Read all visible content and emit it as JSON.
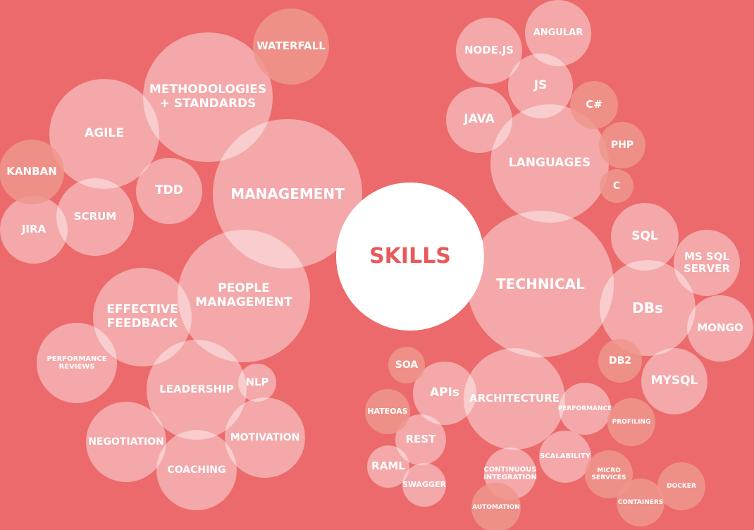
{
  "bubbles": [
    {
      "id": "waterfall",
      "label": "WATERFALL",
      "alt": true
    },
    {
      "id": "methodologies",
      "label": "METHODOLOGIES\n+ STANDARDS"
    },
    {
      "id": "agile",
      "label": "AGILE"
    },
    {
      "id": "management",
      "label": "MANAGEMENT"
    },
    {
      "id": "kanban",
      "label": "KANBAN",
      "alt": true
    },
    {
      "id": "tdd",
      "label": "TDD"
    },
    {
      "id": "jira",
      "label": "JIRA"
    },
    {
      "id": "scrum",
      "label": "SCRUM"
    },
    {
      "id": "people-management",
      "label": "PEOPLE\nMANAGEMENT"
    },
    {
      "id": "effective-feedback",
      "label": "EFFECTIVE\nFEEDBACK"
    },
    {
      "id": "performance-reviews",
      "label": "PERFORMANCE\nREVIEWS"
    },
    {
      "id": "leadership",
      "label": "LEADERSHIP"
    },
    {
      "id": "nlp",
      "label": "NLP"
    },
    {
      "id": "negotiation",
      "label": "NEGOTIATION"
    },
    {
      "id": "motivation",
      "label": "MOTIVATION"
    },
    {
      "id": "coaching",
      "label": "COACHING"
    },
    {
      "id": "skills",
      "label": "SKILLS",
      "core": true
    },
    {
      "id": "node-js",
      "label": "NODE.JS"
    },
    {
      "id": "angular",
      "label": "ANGULAR"
    },
    {
      "id": "js",
      "label": "JS"
    },
    {
      "id": "c-sharp",
      "label": "C#",
      "alt": true
    },
    {
      "id": "java",
      "label": "JAVA"
    },
    {
      "id": "languages",
      "label": "LANGUAGES"
    },
    {
      "id": "php",
      "label": "PHP",
      "alt": true
    },
    {
      "id": "c",
      "label": "C",
      "alt": true
    },
    {
      "id": "sql",
      "label": "SQL"
    },
    {
      "id": "ms-sql-server",
      "label": "MS SQL\nSERVER"
    },
    {
      "id": "technical",
      "label": "TECHNICAL"
    },
    {
      "id": "dbs",
      "label": "DBs"
    },
    {
      "id": "mongo",
      "label": "MONGO"
    },
    {
      "id": "db2",
      "label": "DB2",
      "alt": true
    },
    {
      "id": "mysql",
      "label": "MYSQL"
    },
    {
      "id": "soa",
      "label": "SOA",
      "alt": true
    },
    {
      "id": "apis",
      "label": "APIs"
    },
    {
      "id": "architecture",
      "label": "ARCHITECTURE"
    },
    {
      "id": "hateoas",
      "label": "HATEOAS",
      "alt": true
    },
    {
      "id": "rest",
      "label": "REST"
    },
    {
      "id": "performance",
      "label": "PERFORMANCE"
    },
    {
      "id": "profiling",
      "label": "PROFILING",
      "alt": true
    },
    {
      "id": "raml",
      "label": "RAML"
    },
    {
      "id": "swagger",
      "label": "SWAGGER"
    },
    {
      "id": "continuous-integration",
      "label": "CONTINUOUS\nINTEGRATION"
    },
    {
      "id": "scalability",
      "label": "SCALABILITY"
    },
    {
      "id": "micro-services",
      "label": "MICRO\nSERVICES",
      "alt": true
    },
    {
      "id": "docker",
      "label": "DOCKER",
      "alt": true
    },
    {
      "id": "containers",
      "label": "CONTAINERS",
      "alt": true
    },
    {
      "id": "automation",
      "label": "AUTOMATION",
      "alt": true
    }
  ]
}
